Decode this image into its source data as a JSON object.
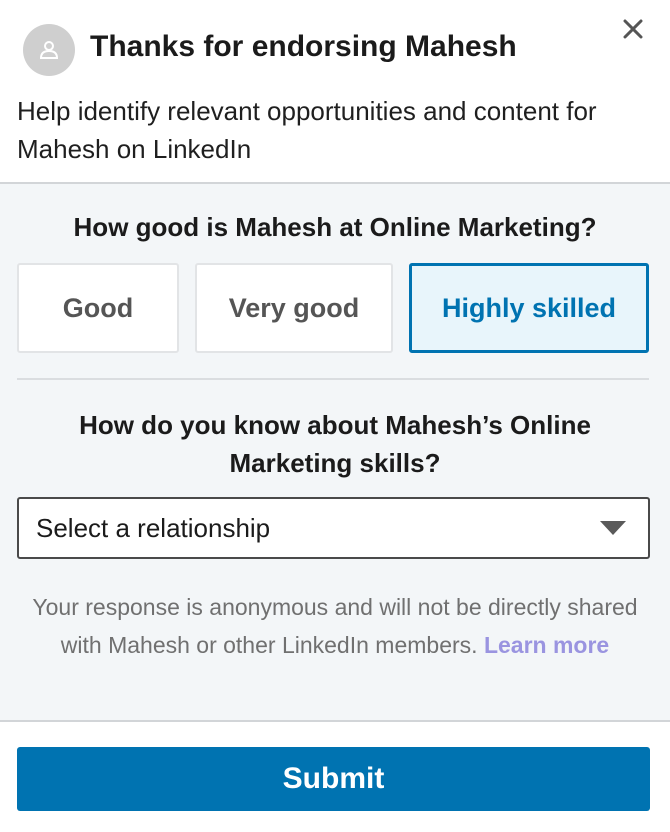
{
  "header": {
    "avatar_icon": "person-icon",
    "title": "Thanks for endorsing Mahesh",
    "close_icon": "close-icon",
    "subtitle": "Help identify relevant opportunities and content for Mahesh on LinkedIn"
  },
  "skill_question": {
    "prompt": "How good is Mahesh at Online Marketing?",
    "options": [
      {
        "label": "Good",
        "selected": false
      },
      {
        "label": "Very good",
        "selected": false
      },
      {
        "label": "Highly skilled",
        "selected": true
      }
    ]
  },
  "relationship_question": {
    "prompt": "How do you know about Mahesh’s Online Marketing skills?",
    "select_value": "Select a relationship",
    "caret_icon": "chevron-down-icon"
  },
  "disclaimer": {
    "text": "Your response is anonymous and will not be directly shared with Mahesh or other LinkedIn members.",
    "link": "Learn more"
  },
  "actions": {
    "submit_label": "Submit"
  },
  "colors": {
    "accent": "#0073b1",
    "panel_bg": "#f3f6f8",
    "selected_bg": "#e8f5fb",
    "link": "#9a94e0"
  }
}
